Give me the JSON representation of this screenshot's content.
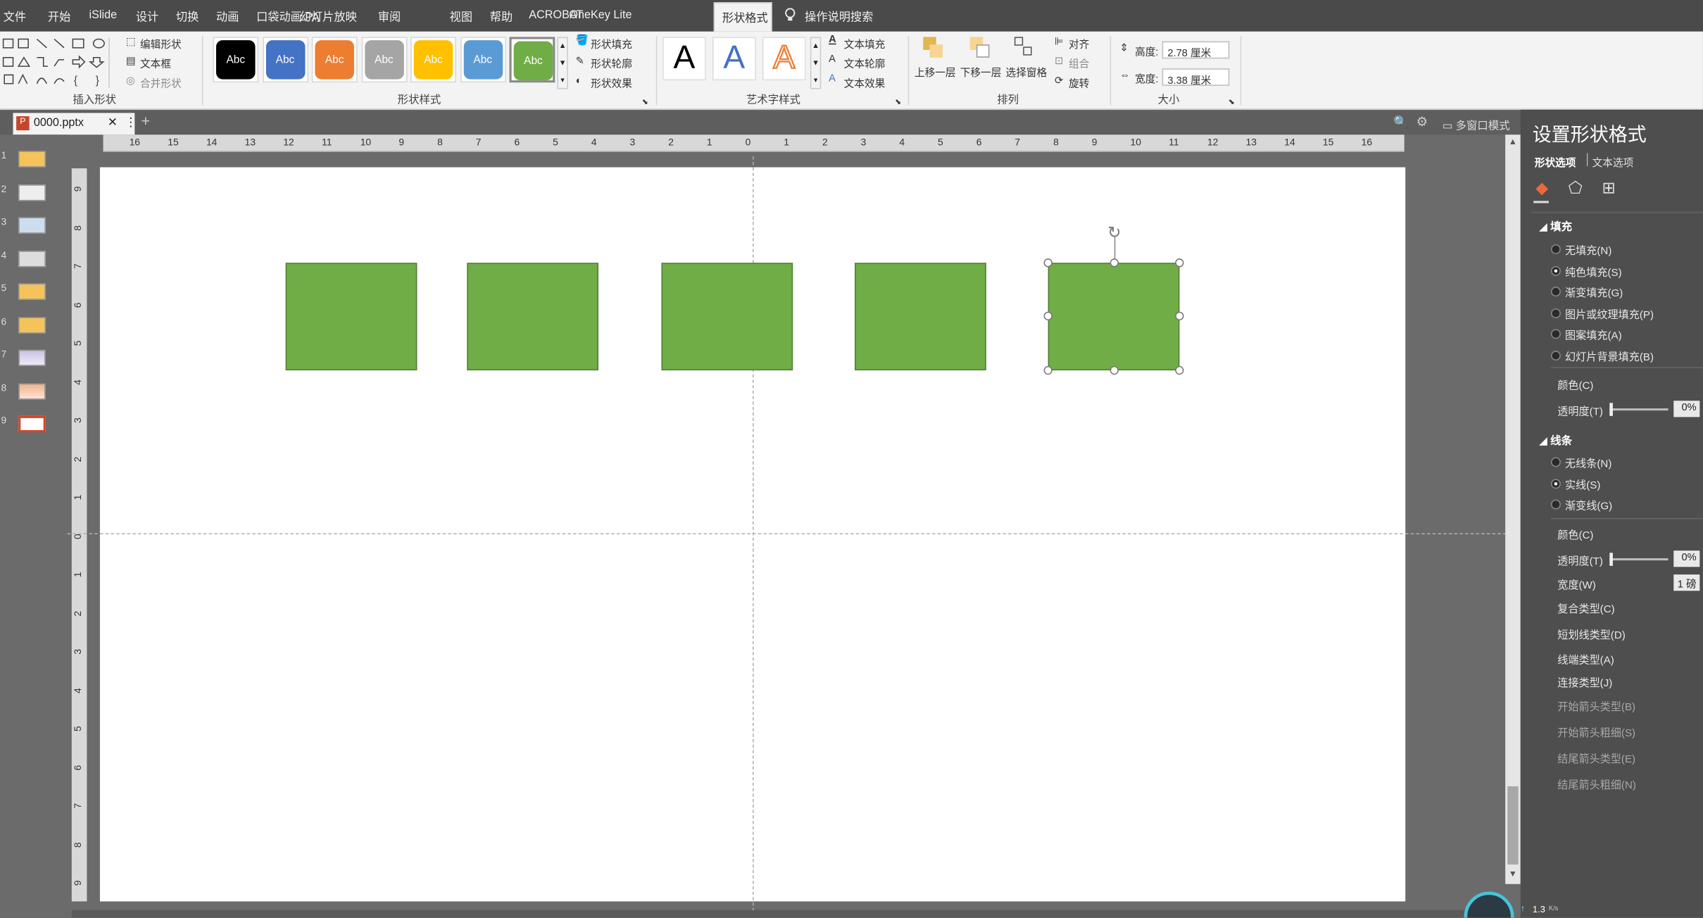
{
  "menu": [
    "文件",
    "开始",
    "iSlide",
    "设计",
    "切换",
    "动画",
    "口袋动画 PA",
    "幻灯片放映",
    "审阅",
    "视图",
    "帮助",
    "ACROBAT",
    "OneKey Lite"
  ],
  "active_tab": "形状格式",
  "tell_me": "操作说明搜索",
  "ribbon": {
    "insert_shape": {
      "edit_shape": "编辑形状",
      "text_box": "文本框",
      "merge_shapes": "合并形状",
      "group_label": "插入形状"
    },
    "shape_styles": {
      "samples": [
        {
          "label": "Abc",
          "color": "#000000"
        },
        {
          "label": "Abc",
          "color": "#4472c4"
        },
        {
          "label": "Abc",
          "color": "#ed7d31"
        },
        {
          "label": "Abc",
          "color": "#a5a5a5"
        },
        {
          "label": "Abc",
          "color": "#ffc000"
        },
        {
          "label": "Abc",
          "color": "#5b9bd5"
        },
        {
          "label": "Abc",
          "color": "#70ad47"
        }
      ],
      "fill": "形状填充",
      "outline": "形状轮廓",
      "effects": "形状效果",
      "group_label": "形状样式"
    },
    "wordart": {
      "samples": [
        "A",
        "A",
        "A"
      ],
      "text_fill": "文本填充",
      "text_outline": "文本轮廓",
      "text_effects": "文本效果",
      "group_label": "艺术字样式"
    },
    "arrange": {
      "bring_forward": "上移一层",
      "send_backward": "下移一层",
      "selection_pane": "选择窗格",
      "align": "对齐",
      "group": "组合",
      "rotate": "旋转",
      "group_label": "排列"
    },
    "size": {
      "height_label": "高度:",
      "height_value": "2.78 厘米",
      "width_label": "宽度:",
      "width_value": "3.38 厘米",
      "group_label": "大小"
    }
  },
  "document": {
    "tab_name": "0000.pptx",
    "multi_window": "多窗口模式"
  },
  "hruler_ticks": [
    "16",
    "15",
    "14",
    "13",
    "12",
    "11",
    "10",
    "9",
    "8",
    "7",
    "6",
    "5",
    "4",
    "3",
    "2",
    "1",
    "0",
    "1",
    "2",
    "3",
    "4",
    "5",
    "6",
    "7",
    "8",
    "9",
    "10",
    "11",
    "12",
    "13",
    "14",
    "15",
    "16"
  ],
  "vruler_ticks": [
    "9",
    "8",
    "7",
    "6",
    "5",
    "4",
    "3",
    "2",
    "1",
    "0",
    "1",
    "2",
    "3",
    "4",
    "5",
    "6",
    "7",
    "8",
    "9"
  ],
  "slide_numbers": [
    "1",
    "2",
    "3",
    "4",
    "5",
    "6",
    "7",
    "8",
    "9"
  ],
  "shape_fill_color": "#70ad47",
  "format_pane": {
    "title": "设置形状格式",
    "tab_shape": "形状选项",
    "tab_text": "文本选项",
    "fill": {
      "header": "填充",
      "options": [
        "无填充(N)",
        "纯色填充(S)",
        "渐变填充(G)",
        "图片或纹理填充(P)",
        "图案填充(A)",
        "幻灯片背景填充(B)"
      ],
      "selected": 1,
      "color_label": "颜色(C)",
      "transparency_label": "透明度(T)",
      "transparency_value": "0%"
    },
    "line": {
      "header": "线条",
      "options": [
        "无线条(N)",
        "实线(S)",
        "渐变线(G)"
      ],
      "selected": 1,
      "color_label": "颜色(C)",
      "transparency_label": "透明度(T)",
      "transparency_value": "0%",
      "width_label": "宽度(W)",
      "width_value": "1 磅",
      "compound_label": "复合类型(C)",
      "dash_label": "短划线类型(D)",
      "cap_label": "线端类型(A)",
      "join_label": "连接类型(J)",
      "begin_arrow_type": "开始箭头类型(B)",
      "begin_arrow_size": "开始箭头粗细(S)",
      "end_arrow_type": "结尾箭头类型(E)",
      "end_arrow_size": "结尾箭头粗细(N)"
    }
  },
  "net_speed": "1.3",
  "net_unit": "K/s"
}
